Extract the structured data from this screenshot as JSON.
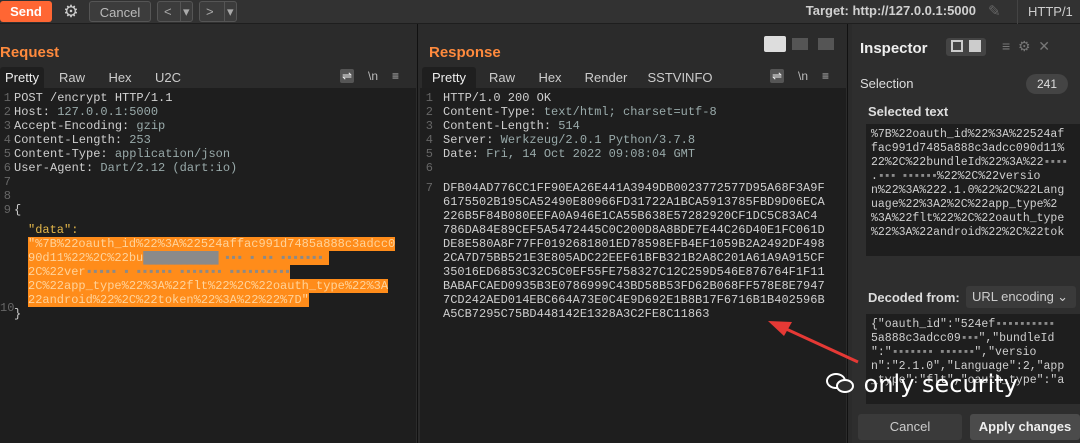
{
  "toolbar": {
    "send": "Send",
    "cancel": "Cancel",
    "prev": "<",
    "next": ">",
    "dropdown": "▾",
    "target": "Target: http://127.0.0.1:5000",
    "http_version": "HTTP/1"
  },
  "request": {
    "title": "Request",
    "tabs": [
      "Pretty",
      "Raw",
      "Hex",
      "U2C"
    ],
    "wrap_icon": "\\n",
    "menu_icon": "≡",
    "lines": [
      "1",
      "2",
      "3",
      "4",
      "5",
      "6",
      "7",
      "8",
      "9",
      "",
      "10"
    ],
    "headers": [
      {
        "k": "POST",
        "v": " /encrypt HTTP/1.1"
      },
      {
        "k": "Host:",
        "v": " 127.0.0.1:5000"
      },
      {
        "k": "Accept-Encoding:",
        "v": " gzip"
      },
      {
        "k": "Content-Length:",
        "v": " 253"
      },
      {
        "k": "Content-Type:",
        "v": " application/json"
      },
      {
        "k": "User-Agent:",
        "v": " Dart/2.12 (dart:io)"
      }
    ],
    "body_open": "{",
    "json_key": "\"data\":",
    "json_value_lines": [
      "\"%7B%22oauth_id%22%3A%22524affac991d7485a888c3adcc0",
      "90d11%22%2C%22bu",
      "2C%22ver",
      "2C%22app_type%22%3A%22flt%22%2C%22oauth_type%22%3A",
      "22android%22%2C%22token%22%3A%22%22%7D\""
    ],
    "body_close": "}"
  },
  "response": {
    "title": "Response",
    "tabs": [
      "Pretty",
      "Raw",
      "Hex",
      "Render",
      "SSTVINFO"
    ],
    "lines": [
      "1",
      "2",
      "3",
      "4",
      "5",
      "6",
      "7"
    ],
    "status": "HTTP/1.0 200 OK",
    "headers": [
      {
        "k": "Content-Type:",
        "v": " text/html; charset=utf-8"
      },
      {
        "k": "Content-Length:",
        "v": " 514"
      },
      {
        "k": "Server:",
        "v": " Werkzeug/2.0.1 Python/3.7.8"
      },
      {
        "k": "Date:",
        "v": " Fri, 14 Oct 2022 09:08:04 GMT"
      }
    ],
    "body_lines": [
      "DFB04AD776CC1FF90EA26E441A3949DB0023772577D95A68F3A9F",
      "6175502B195CA52490E80966FD31722A1BCA5913785FBD9D06ECA",
      "226B5F84B080EEFA0A946E1CA55B638E57282920CF1DC5C83AC4",
      "786DA84E89CEF5A5472445C0C200D8A8BDE7E44C26D40E1FC061D",
      "DE8E580A8F77FF0192681801ED78598EFB4EF1059B2A2492DF498",
      "2CA7D75BB521E3E805ADC22EEF61BFB321B2A8C201A61A9A915CF",
      "35016ED6853C32C5C0EF55FE758327C12C259D546E876764F1F11",
      "BABAFCAED0935B3E0786999C43BD58B53FD62B068FF578E8E7947",
      "7CD242AED014EBC664A73E0C4E9D692E1B8B17F6716B1B402596B",
      "A5CB7295C75BD448142E1328A3C2FE8C11863"
    ]
  },
  "inspector": {
    "title": "Inspector",
    "selection_label": "Selection",
    "selection_count": "241",
    "selected_text_label": "Selected text",
    "selected_text_lines": [
      "%7B%22oauth_id%22%3A%22524af",
      "fac991d7485a888c3adcc090d11%",
      "22%2C%22bundleId%22%3A%22",
      ".",
      "n%22%3A%222.1.0%22%2C%22Lang",
      "uage%22%3A2%2C%22app_type%2",
      "%3A%22flt%22%2C%22oauth_type",
      "%22%3A%22android%22%2C%22tok"
    ],
    "decoded_from_label": "Decoded from:",
    "decoded_from_value": "URL encoding",
    "decoded_lines": [
      "{\"oauth_id\":\"524ef",
      "5a888c3adcc09",
      "\":\"",
      "n\":\"2.1.0\",\"Language\":2,\"app",
      "_type\":\"flt\",\"oauth_type\":\"a"
    ],
    "cancel": "Cancel",
    "apply": "Apply changes"
  },
  "watermark": "only security",
  "colors": {
    "send": "#ff6633",
    "accent": "#ff8a3d",
    "highlight": "#ff8c1a",
    "arrow": "#e53935"
  }
}
